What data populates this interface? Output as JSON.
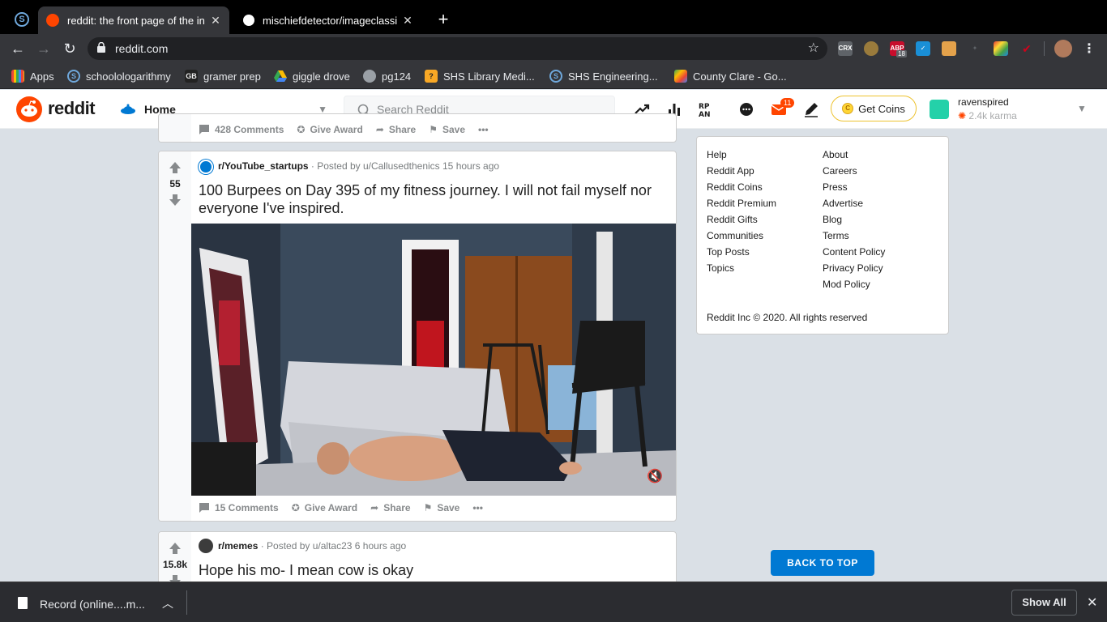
{
  "browser": {
    "tabs": [
      {
        "title": "reddit: the front page of the int",
        "active": true
      },
      {
        "title": "mischiefdetector/imageclassifi",
        "active": false
      }
    ],
    "url": "reddit.com",
    "extensions": [
      {
        "label": "CRX",
        "color": "#5f6368"
      },
      {
        "label": "",
        "color": "#9a7b3c"
      },
      {
        "label": "ABP",
        "color": "#c70d2c"
      },
      {
        "label": "",
        "color": "#1a8fd6"
      },
      {
        "label": "",
        "color": "#e4a24b"
      },
      {
        "label": "",
        "color": "#35363a"
      },
      {
        "label": "",
        "color": "#8f2fd6"
      },
      {
        "label": "",
        "color": "#d0021b"
      }
    ],
    "abp_count": "18"
  },
  "bookmarks": [
    {
      "label": "Apps",
      "icon": "apps-grid-icon",
      "color": "#e8453c"
    },
    {
      "label": "schoolologarithmy",
      "icon": "schoology-icon",
      "color": "#6fa8dc"
    },
    {
      "label": "gramer prep",
      "icon": "gb-icon",
      "color": "#333333"
    },
    {
      "label": "giggle drove",
      "icon": "drive-icon",
      "color": "#fbbc04"
    },
    {
      "label": "pg124",
      "icon": "globe-icon",
      "color": "#9aa0a6"
    },
    {
      "label": "SHS Library Medi...",
      "icon": "library-icon",
      "color": "#f9a825"
    },
    {
      "label": "SHS Engineering...",
      "icon": "schoology-icon",
      "color": "#6fa8dc"
    },
    {
      "label": "County Clare - Go...",
      "icon": "maps-icon",
      "color": "#34a853"
    }
  ],
  "header": {
    "wordmark": "reddit",
    "feed": "Home",
    "search_placeholder": "Search Reddit",
    "notifications": "11",
    "coins_label": "Get Coins",
    "username": "ravenspired",
    "karma": "2.4k karma"
  },
  "partial_post": {
    "comments": "428 Comments",
    "award": "Give Award",
    "share": "Share",
    "save": "Save"
  },
  "posts": [
    {
      "subreddit": "r/YouTube_startups",
      "posted_by": "· Posted by u/Callusedthenics 15 hours ago",
      "score": "55",
      "title": "100 Burpees on Day 395 of my fitness journey. I will not fail myself nor everyone I've inspired.",
      "comments": "15 Comments",
      "award": "Give Award",
      "share": "Share",
      "save": "Save"
    },
    {
      "subreddit": "r/memes",
      "posted_by": "· Posted by u/altac23 6 hours ago",
      "score": "15.8k",
      "title": "Hope his mo- I mean cow is okay"
    }
  ],
  "sidebar": {
    "left_links": [
      "Help",
      "Reddit App",
      "Reddit Coins",
      "Reddit Premium",
      "Reddit Gifts",
      "Communities",
      "Top Posts",
      "Topics"
    ],
    "right_links": [
      "About",
      "Careers",
      "Press",
      "Advertise",
      "Blog",
      "Terms",
      "Content Policy",
      "Privacy Policy",
      "Mod Policy"
    ],
    "copyright": "Reddit Inc © 2020. All rights reserved"
  },
  "back_to_top": "BACK TO TOP",
  "download": {
    "file": "Record (online....m...",
    "show_all": "Show All"
  },
  "colors": {
    "reddit_orange": "#ff4500",
    "reddit_blue": "#0079d3",
    "page_bg": "#dae0e6"
  }
}
